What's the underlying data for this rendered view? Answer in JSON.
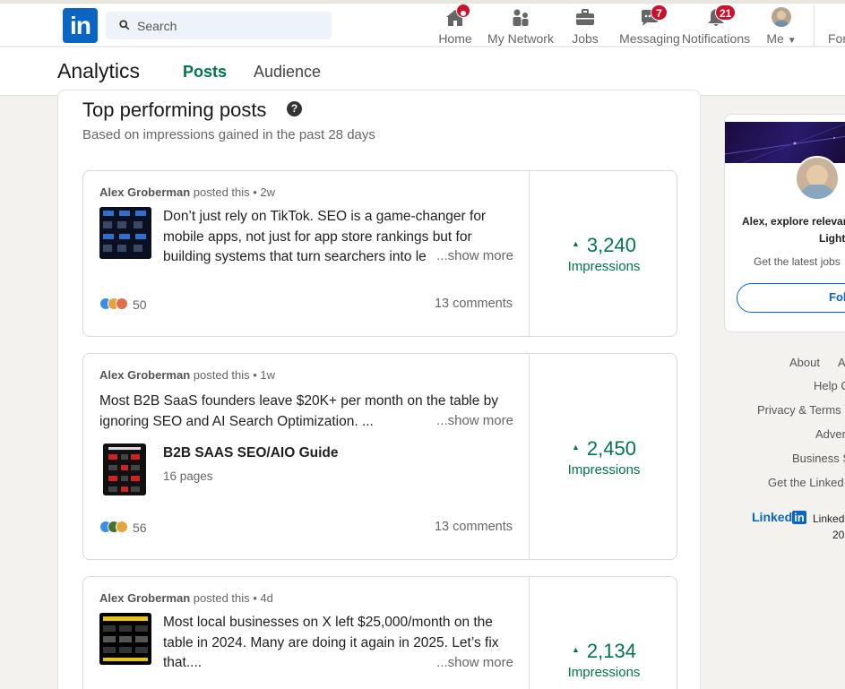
{
  "nav": {
    "search_placeholder": "Search",
    "items": [
      {
        "label": "Home",
        "icon": "home-icon"
      },
      {
        "label": "My Network",
        "icon": "network-icon"
      },
      {
        "label": "Jobs",
        "icon": "briefcase-icon"
      },
      {
        "label": "Messaging",
        "icon": "messaging-icon",
        "badge": "7"
      },
      {
        "label": "Notifications",
        "icon": "bell-icon",
        "badge": "21"
      },
      {
        "label": "Me",
        "icon": "avatar"
      },
      {
        "label": "For"
      }
    ],
    "accent": "#0a66c2",
    "badge_color": "#cb112d"
  },
  "subheader": {
    "title": "Analytics",
    "tabs": [
      {
        "label": "Posts",
        "active": true
      },
      {
        "label": "Audience",
        "active": false
      }
    ]
  },
  "main": {
    "title": "Top performing posts",
    "subtitle": "Based on impressions gained in the past 28 days",
    "posts": [
      {
        "author": "Alex Groberman",
        "suffix": "posted this • 2w",
        "text": "Don’t just rely on TikTok. SEO is a game-changer for mobile apps, not just for app store rankings but for building systems that turn searchers into le",
        "show_more": "...show more",
        "reactions": "50",
        "comments": "13 comments",
        "impressions": "3,240",
        "impressions_label": "Impressions"
      },
      {
        "author": "Alex Groberman",
        "suffix": "posted this • 1w",
        "text": "Most B2B SaaS founders leave $20K+ per month on the table by ignoring SEO and AI Search Optimization. ...",
        "show_more": "...show more",
        "doc_title": "B2B SAAS SEO/AIO Guide",
        "doc_pages": "16 pages",
        "reactions": "56",
        "comments": "13 comments",
        "impressions": "2,450",
        "impressions_label": "Impressions"
      },
      {
        "author": "Alex Groberman",
        "suffix": "posted this • 4d",
        "text": "Most local businesses on X left $25,000/month on the table in 2024. Many are doing it again in 2025. Let’s fix that....",
        "show_more": "...show more",
        "impressions": "2,134",
        "impressions_label": "Impressions"
      }
    ],
    "impressions_color": "#01754f"
  },
  "rail": {
    "line1": "Alex, explore relevar",
    "line2": "Light",
    "line3": "Get the latest jobs",
    "follow": "Fol",
    "footer_links": [
      "About",
      "A",
      "Help C",
      "Privacy & Terms",
      "Adver",
      "Business S",
      "Get the Linked"
    ],
    "footer_brand": "Linked",
    "footer_brand_in": "in",
    "footer_corp": "Linked",
    "footer_year": "20"
  }
}
